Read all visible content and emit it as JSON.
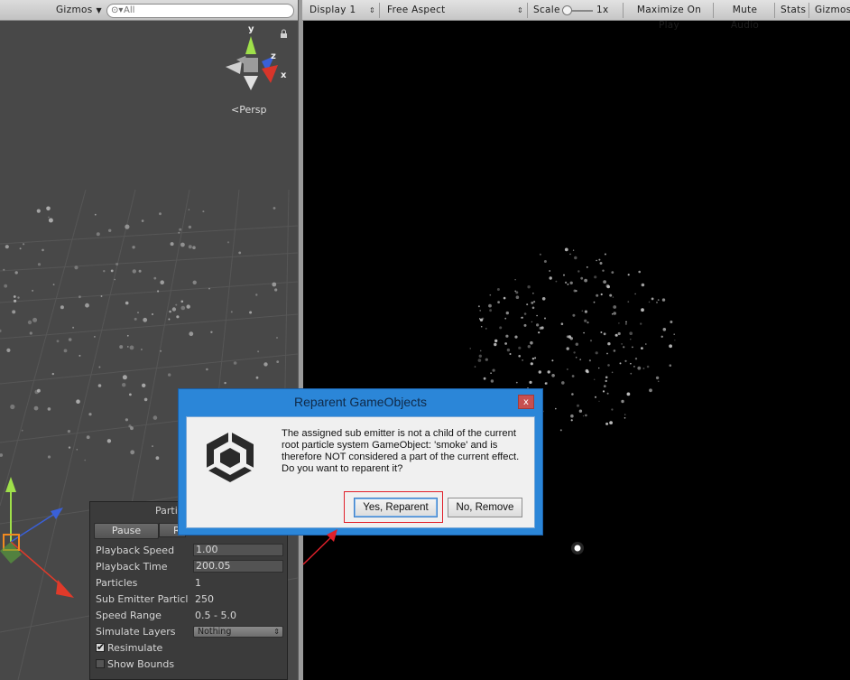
{
  "scene_view": {
    "toolbar": {
      "gizmos_label": "Gizmos",
      "search_placeholder": "All"
    },
    "orientation_gizmo": {
      "axis_y": "y",
      "axis_z": "z",
      "axis_x": "x",
      "projection_label": "Persp"
    }
  },
  "game_view": {
    "toolbar": {
      "display": "Display 1",
      "aspect": "Free Aspect",
      "scale_label": "Scale",
      "scale_value": "1x",
      "maximize": "Maximize On Play",
      "mute": "Mute Audio",
      "stats": "Stats",
      "gizmos": "Gizmos"
    }
  },
  "particle_panel": {
    "title": "Parti",
    "pause_label": "Pause",
    "restart_label": "R",
    "properties": [
      {
        "label": "Playback Speed",
        "value": "1.00"
      },
      {
        "label": "Playback Time",
        "value": "200.05"
      },
      {
        "label": "Particles",
        "value": "1"
      },
      {
        "label": "Sub Emitter Particl",
        "value": "250"
      },
      {
        "label": "Speed Range",
        "value": "0.5 - 5.0"
      },
      {
        "label": "Simulate Layers",
        "value": "Nothing"
      }
    ],
    "resimulate": {
      "label": "Resimulate",
      "checked": true
    },
    "show_bounds": {
      "label": "Show Bounds",
      "checked": false
    }
  },
  "dialog": {
    "title": "Reparent GameObjects",
    "close": "x",
    "message_lines": [
      "The assigned sub emitter is not a child of the current",
      "root particle system GameObject: 'smoke' and is",
      "therefore NOT considered a part of the current effect.",
      "Do you want to reparent it?"
    ],
    "yes_label": "Yes, Reparent",
    "no_label": "No, Remove"
  },
  "colors": {
    "dialog_frame": "#2b86d8",
    "annotation": "#e0202a",
    "scene_bg": "#484848"
  }
}
